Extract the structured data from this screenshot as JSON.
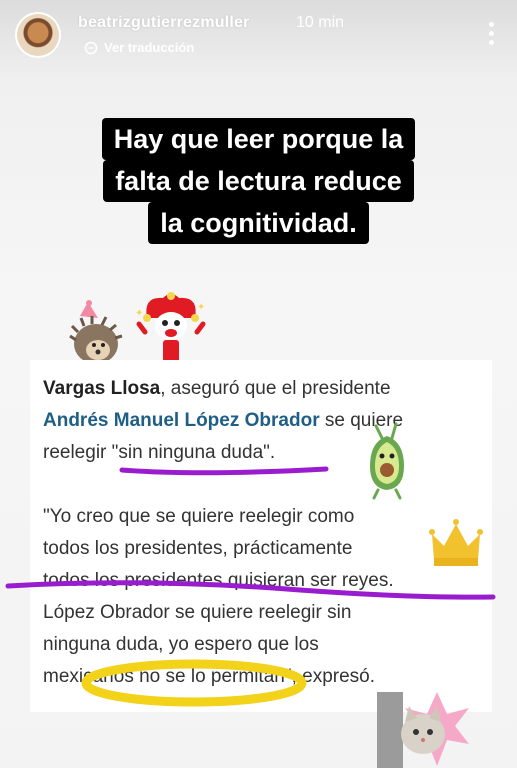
{
  "header": {
    "username": "beatrizgutierrezmuller",
    "time": "10 min",
    "translate_label": "Ver traducción"
  },
  "headline": {
    "lines": [
      "Hay que leer porque la",
      "falta de lectura reduce",
      "la cognitividad."
    ]
  },
  "article": {
    "p1_author": "Vargas Llosa",
    "p1_text1": ", aseguró que el presidente",
    "p1_name": "Andrés Manuel López Obrador",
    "p1_text2": " se quiere",
    "p1_line3_pre": "reelegir ",
    "p1_quote": "\"sin ninguna duda\".",
    "p2_line1": "\"Yo creo que se quiere reelegir como",
    "p2_line2": "todos los presidentes, prácticamente",
    "p2_line3": "todos los presidentes quisieran ser reyes.",
    "p2_line4": "López Obrador se quiere reelegir sin",
    "p2_line5": "ninguna duda, yo espero que los",
    "p2_line6": "mexicanos no se lo permitan\", expresó."
  },
  "colors": {
    "underline_purple": "#9a1ccf",
    "circle_yellow": "#f3d21a",
    "name_blue": "#1f5f86"
  },
  "icons": [
    "translate-icon",
    "more-options-icon",
    "hedgehog-sticker",
    "jester-sticker",
    "avocado-sticker",
    "crown-sticker",
    "cat-sticker"
  ]
}
